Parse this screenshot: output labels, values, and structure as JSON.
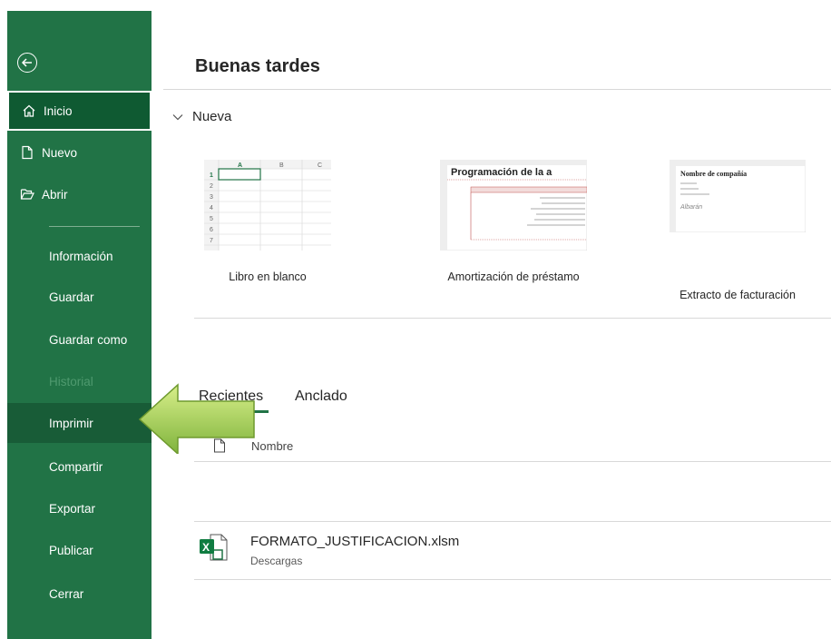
{
  "sidebar": {
    "primary": [
      {
        "label": "Inicio",
        "icon": "home-icon"
      },
      {
        "label": "Nuevo",
        "icon": "new-document-icon"
      },
      {
        "label": "Abrir",
        "icon": "folder-open-icon"
      }
    ],
    "secondary": [
      {
        "label": "Información"
      },
      {
        "label": "Guardar"
      },
      {
        "label": "Guardar como"
      },
      {
        "label": "Historial"
      },
      {
        "label": "Imprimir"
      },
      {
        "label": "Compartir"
      },
      {
        "label": "Exportar"
      },
      {
        "label": "Publicar"
      },
      {
        "label": "Cerrar"
      }
    ],
    "back_icon": "back-arrow-icon",
    "bg_color": "#217346"
  },
  "main": {
    "greeting": "Buenas tardes",
    "nueva_label": "Nueva",
    "templates": [
      {
        "name": "Libro en blanco"
      },
      {
        "name": "Amortización de préstamo",
        "preview_title": "Programación de la a"
      },
      {
        "name": "Extracto de facturación",
        "preview_title": "Nombre de compañía",
        "preview_sign": "Albarán"
      }
    ],
    "tabs": [
      {
        "label": "Recientes",
        "active": true
      },
      {
        "label": "Anclado",
        "active": false
      }
    ],
    "column_header": "Nombre",
    "recent_files": [
      {
        "name": "FORMATO_JUSTIFICACION.xlsm",
        "location": "Descargas",
        "icon": "excel-file-icon"
      }
    ]
  }
}
